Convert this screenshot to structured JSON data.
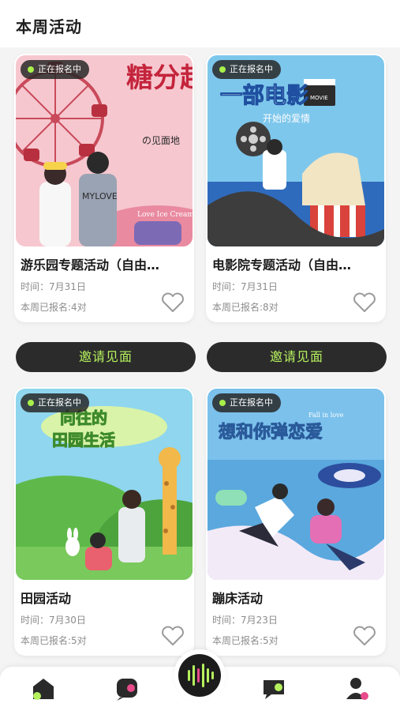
{
  "header": {
    "title": "本周活动"
  },
  "badge_text": "正在报名中",
  "cards": [
    {
      "title": "游乐园专题活动（自由…",
      "time": "时间：7月31日",
      "count": "本周已报名:4对",
      "poster_text_1": "糖分超标",
      "poster_text_2": "の见面地",
      "poster_text_3": "MYLOVE",
      "poster_text_4": "Love Ice Cream"
    },
    {
      "title": "电影院专题活动（自由…",
      "time": "时间：7月31日",
      "count": "本周已报名:8对",
      "poster_text_1": "一部电影",
      "poster_text_2": "开始的爱情",
      "poster_text_3": "MOVIE"
    },
    {
      "title": "田园活动",
      "time": "时间：7月30日",
      "count": "本周已报名:5对",
      "poster_text_1": "向往的",
      "poster_text_2": "田园生活"
    },
    {
      "title": "蹦床活动",
      "time": "时间：7月23日",
      "count": "本周已报名:5对",
      "poster_text_1": "想和你弹恋爱",
      "poster_text_2": "Fall in love"
    }
  ],
  "invite_label": "邀请见面",
  "tabs": [
    {
      "icon": "home-icon"
    },
    {
      "icon": "chat-icon"
    },
    {
      "icon": "voice-wave-icon"
    },
    {
      "icon": "message-icon"
    },
    {
      "icon": "profile-icon"
    }
  ],
  "colors": {
    "accent": "#b6f25e",
    "dark": "#2b2b2b",
    "badge_dot": "#a8f04a"
  }
}
